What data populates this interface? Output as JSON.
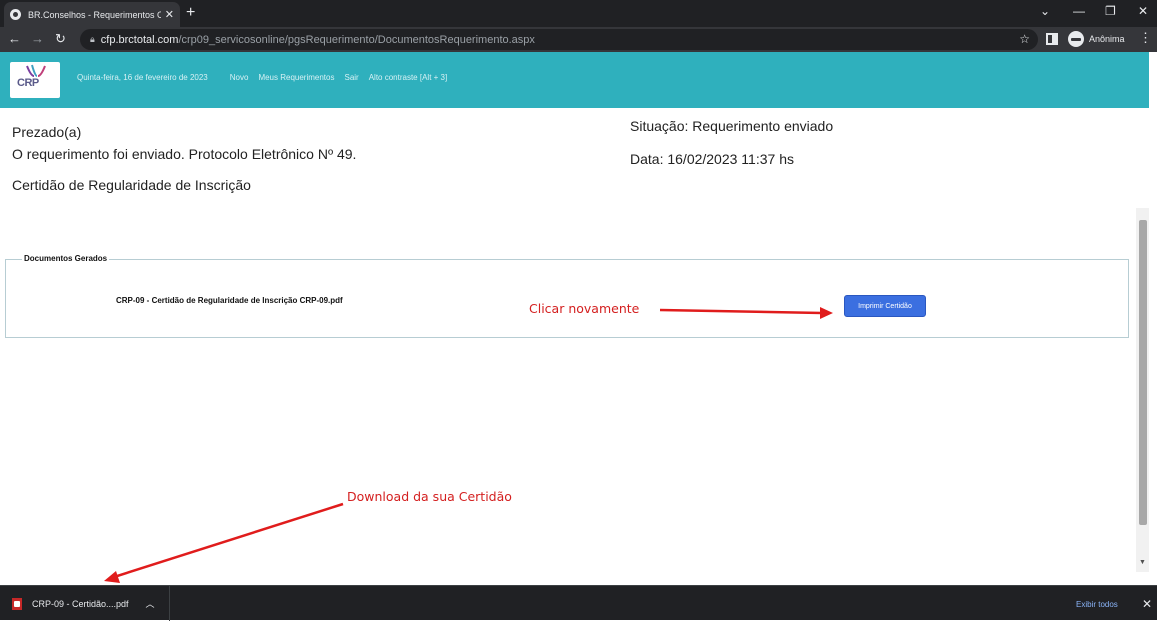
{
  "browser": {
    "tab_title": "BR.Conselhos - Requerimentos O",
    "new_tab": "+",
    "url_host": "cfp.brctotal.com",
    "url_path": "/crp09_servicosonline/pgsRequerimento/DocumentosRequerimento.aspx",
    "profile_label": "Anônima"
  },
  "header": {
    "logo_text": "CRP",
    "date": "Quinta-feira, 16 de fevereiro de 2023",
    "links": [
      "Novo",
      "Meus Requerimentos",
      "Sair",
      "Alto contraste [Alt + 3]"
    ]
  },
  "content": {
    "greeting": "Prezado(a)",
    "message": "O requerimento foi enviado. Protocolo Eletrônico Nº 49.",
    "request_type": "Certidão de Regularidade de Inscrição",
    "status": "Situação: Requerimento enviado",
    "date": "Data: 16/02/2023 11:37 hs"
  },
  "documents": {
    "legend": "Documentos Gerados",
    "file_name": "CRP-09 - Certidão de Regularidade de Inscrição CRP-09.pdf",
    "button_label": "Imprimir Certidão"
  },
  "annotations": {
    "click_again": "Clicar novamente",
    "download": "Download da sua Certidão",
    "color": "#d42020"
  },
  "download_bar": {
    "file_label": "CRP-09 - Certidão....pdf",
    "show_all": "Exibir todos"
  },
  "colors": {
    "header_bg": "#2fb0bd",
    "button_bg": "#3b6fe0",
    "chrome_dark": "#202124"
  }
}
